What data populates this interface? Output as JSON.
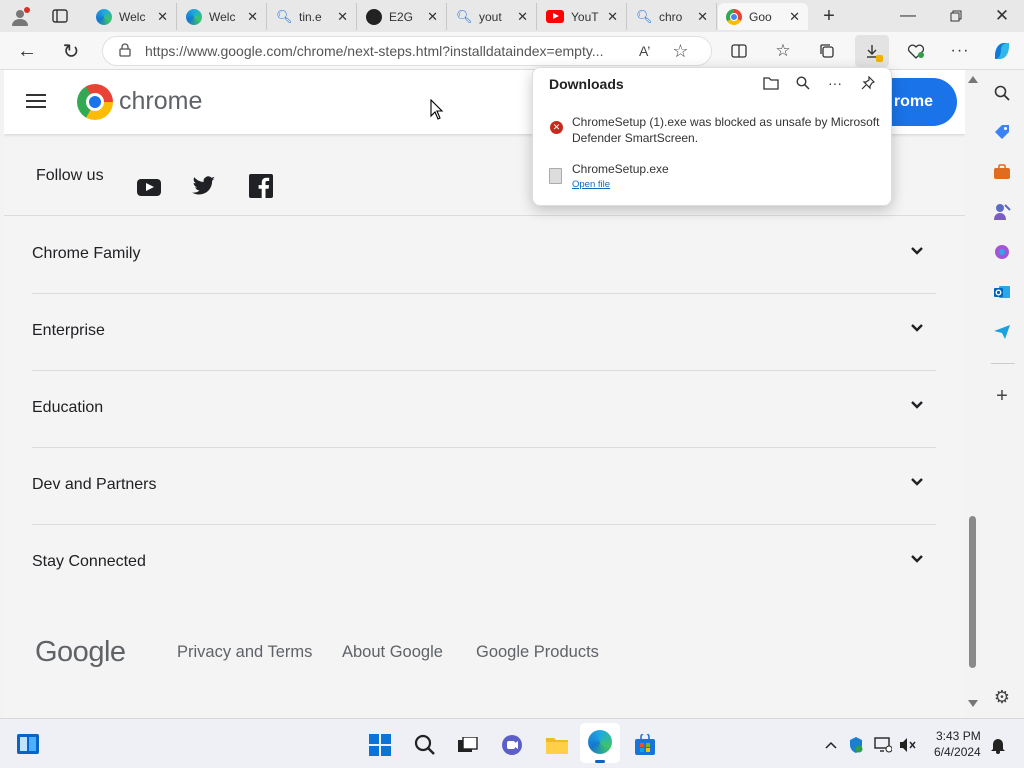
{
  "tabs": [
    {
      "title": "Welc",
      "icon": "edge-icon"
    },
    {
      "title": "Welc",
      "icon": "edge-icon"
    },
    {
      "title": "tin.e",
      "icon": "search-icon"
    },
    {
      "title": "E2G",
      "icon": "github-icon"
    },
    {
      "title": "yout",
      "icon": "search-icon"
    },
    {
      "title": "YouT",
      "icon": "youtube-icon"
    },
    {
      "title": "chro",
      "icon": "search-icon"
    },
    {
      "title": "Goo",
      "icon": "chrome-icon"
    }
  ],
  "address": {
    "url": "https://www.google.com/chrome/next-steps.html?installdataindex=empty..."
  },
  "header": {
    "logo_text": "chrome",
    "button_partial": "rome"
  },
  "follow": {
    "label": "Follow us"
  },
  "sections": [
    {
      "label": "Chrome Family"
    },
    {
      "label": "Enterprise"
    },
    {
      "label": "Education"
    },
    {
      "label": "Dev and Partners"
    },
    {
      "label": "Stay Connected"
    }
  ],
  "footer": {
    "logo": "Google",
    "links": [
      "Privacy and Terms",
      "About Google",
      "Google Products"
    ]
  },
  "downloads": {
    "title": "Downloads",
    "items": [
      {
        "text": "ChromeSetup (1).exe was blocked as unsafe by Microsoft Defender SmartScreen.",
        "status": "blocked"
      },
      {
        "text": "ChromeSetup.exe",
        "link": "Open file"
      }
    ]
  },
  "taskbar": {
    "time": "3:43 PM",
    "date": "6/4/2024"
  },
  "colors": {
    "accent": "#1a73e8",
    "blocked": "#c42b1c"
  }
}
